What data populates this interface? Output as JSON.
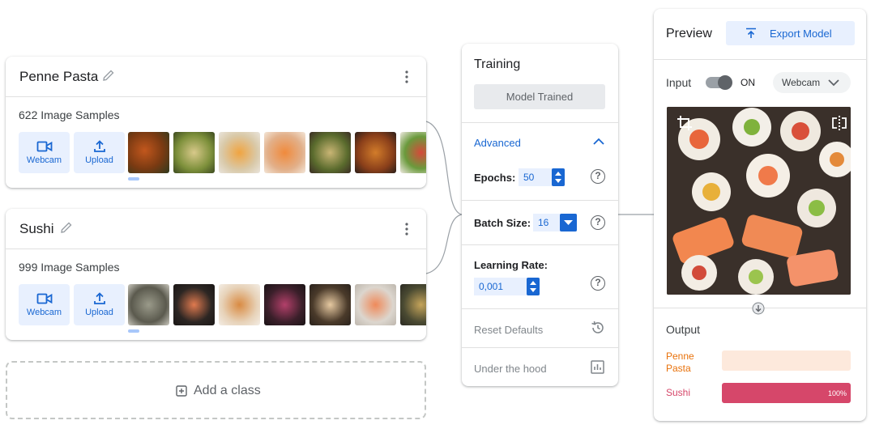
{
  "classes": [
    {
      "name": "Penne Pasta",
      "samples": "622 Image Samples",
      "webcam": "Webcam",
      "upload": "Upload"
    },
    {
      "name": "Sushi",
      "samples": "999 Image Samples",
      "webcam": "Webcam",
      "upload": "Upload"
    }
  ],
  "add_class": "Add a class",
  "training": {
    "title": "Training",
    "train_button": "Model Trained",
    "advanced": "Advanced",
    "epochs_label": "Epochs:",
    "epochs_value": "50",
    "batch_label": "Batch Size:",
    "batch_value": "16",
    "lr_label": "Learning Rate:",
    "lr_value": "0,001",
    "reset": "Reset Defaults",
    "under_hood": "Under the hood",
    "help_glyph": "?"
  },
  "preview": {
    "title": "Preview",
    "export": "Export Model",
    "input_label": "Input",
    "toggle_state": "ON",
    "toggle_on": true,
    "source": "Webcam",
    "output_label": "Output",
    "outputs": [
      {
        "label": "Penne Pasta",
        "value": 0,
        "color": "#e8710a",
        "track": "#fde9dc",
        "text": ""
      },
      {
        "label": "Sushi",
        "value": 1,
        "color": "#d6476a",
        "track": "#fce4ea",
        "text": "100%"
      }
    ]
  },
  "colors": {
    "accent": "#1967d2",
    "accent_light": "#e8f0fe"
  }
}
